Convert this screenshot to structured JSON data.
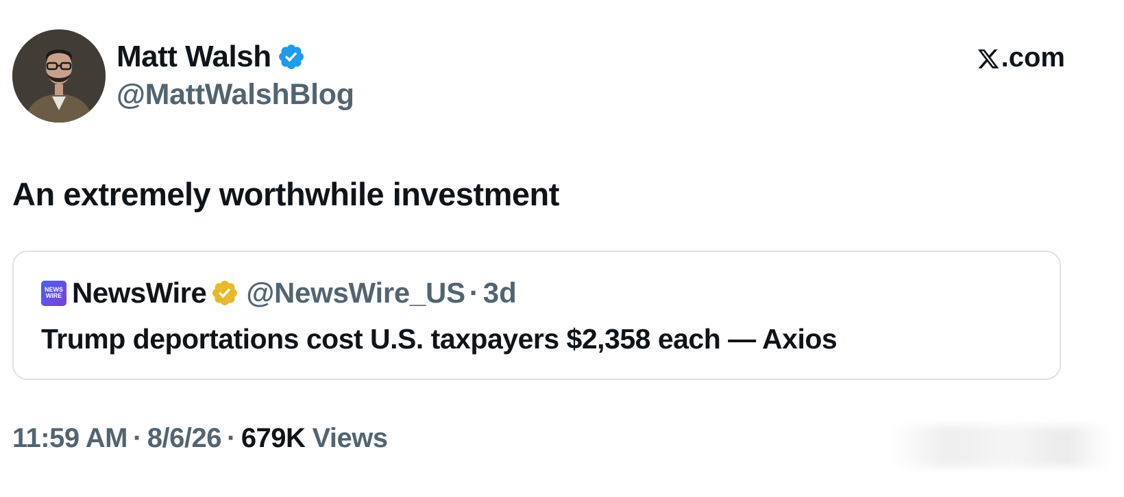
{
  "author": {
    "display_name": "Matt Walsh",
    "handle": "@MattWalshBlog",
    "verified_color": "#1d9bf0"
  },
  "site": {
    "label": ".com",
    "logo_icon": "x-logo-icon"
  },
  "tweet": {
    "text": "An extremely worthwhile investment"
  },
  "quote": {
    "logo_text_line1": "NEWS",
    "logo_text_line2": "WIRE",
    "name": "NewsWire",
    "badge_color": "#e8b829",
    "handle": "@NewsWire_US",
    "separator": "·",
    "time": "3d",
    "text": "Trump deportations cost U.S. taxpayers $2,358 each — Axios"
  },
  "meta": {
    "time": "11:59 AM",
    "separator": "·",
    "date": "8/6/26",
    "views_count": "679K",
    "views_label": "Views"
  }
}
